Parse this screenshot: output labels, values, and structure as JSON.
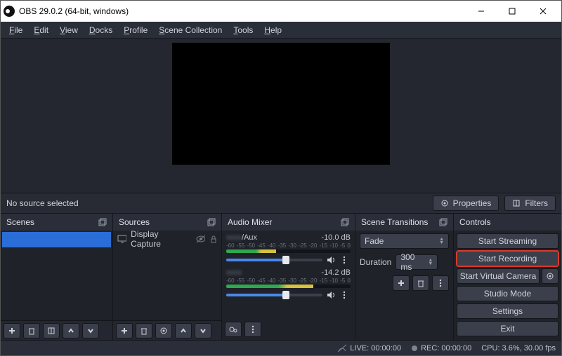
{
  "title": "OBS 29.0.2 (64-bit, windows)",
  "menu": [
    "File",
    "Edit",
    "View",
    "Docks",
    "Profile",
    "Scene Collection",
    "Tools",
    "Help"
  ],
  "no_source": "No source selected",
  "properties": "Properties",
  "filters": "Filters",
  "docks": {
    "scenes": "Scenes",
    "sources": "Sources",
    "mixer": "Audio Mixer",
    "transitions": "Scene Transitions",
    "controls": "Controls"
  },
  "source_item": "Display Capture",
  "mixer": {
    "scale": [
      "-60",
      "-55",
      "-50",
      "-45",
      "-40",
      "-35",
      "-30",
      "-25",
      "-20",
      "-15",
      "-10",
      "-5",
      "0"
    ],
    "tracks": [
      {
        "name_suffix": "/Aux",
        "db": "-10.0 dB",
        "fill_pct": 40,
        "slider_pct": 62
      },
      {
        "name_suffix": "",
        "db": "-14.2 dB",
        "fill_pct": 70,
        "slider_pct": 62
      }
    ]
  },
  "transitions": {
    "selected": "Fade",
    "duration_label": "Duration",
    "duration_value": "300 ms"
  },
  "controls": {
    "start_streaming": "Start Streaming",
    "start_recording": "Start Recording",
    "start_vcam": "Start Virtual Camera",
    "studio_mode": "Studio Mode",
    "settings": "Settings",
    "exit": "Exit"
  },
  "status": {
    "live": "LIVE: 00:00:00",
    "rec": "REC: 00:00:00",
    "cpu": "CPU: 3.6%, 30.00 fps"
  }
}
